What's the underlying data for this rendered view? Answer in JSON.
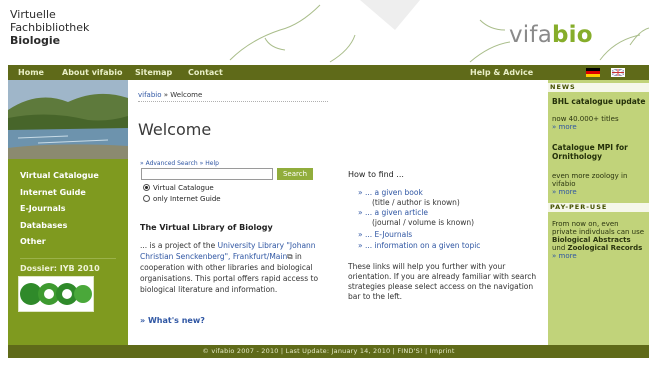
{
  "header": {
    "logo_line1": "Virtuelle",
    "logo_line2": "Fachbibliothek",
    "logo_line3": "Biologie",
    "brand_part1": "vifa",
    "brand_part2": "bio"
  },
  "nav": {
    "home": "Home",
    "about": "About vifabio",
    "sitemap": "Sitemap",
    "contact": "Contact",
    "help": "Help & Advice"
  },
  "leftnav": {
    "items": [
      "Virtual Catalogue",
      "Internet Guide",
      "E-Journals",
      "Databases",
      "Other"
    ],
    "dossier": "Dossier: IYB 2010",
    "logo_text": "2010"
  },
  "main": {
    "breadcrumb_link": "vifabio",
    "breadcrumb_sep": " » ",
    "breadcrumb_current": "Welcome",
    "title": "Welcome",
    "advanced_search": "» Advanced Search",
    "help": "» Help",
    "search_value": "",
    "search_button": "Search",
    "radio1": "Virtual Catalogue",
    "radio2": "only Internet Guide",
    "vlb_title": "The Virtual Library of Biology",
    "vlb_text1": "... is a project of the ",
    "vlb_link": "University Library \"Johann Christian Senckenberg\", Frankfurt/Main",
    "vlb_text2": " in cooperation with other libraries and biological organisations. This portal offers rapid access to biological literature and information.",
    "whats_new": "» What's new?",
    "howto_title": "How to find ...",
    "howto_items": [
      {
        "link": "» ... a given book",
        "sub": "(title / author is known)"
      },
      {
        "link": "» ... a given article",
        "sub": "(journal / volume is known)"
      },
      {
        "link": "» ... E-Journals",
        "sub": ""
      },
      {
        "link": "» ... information on a given topic",
        "sub": ""
      }
    ],
    "howto_text": "These links will help you further with your orientation. If you are already familiar with search strategies please select access on the navigation bar to the left."
  },
  "right": {
    "news_head": "NEWS",
    "news1_title": "BHL catalogue update",
    "news1_text": "now 40.000+ titles",
    "news1_more": "» more",
    "news2_title_l1": "Catalogue MPI for",
    "news2_title_l2": "Ornithology",
    "news2_text_l1": "even more zoology in",
    "news2_text_l2": "vifabio",
    "news2_more": "» more",
    "ppu_head": "PAY-PER-USE",
    "ppu_l1": "From now on, even",
    "ppu_l2": "private indivduals can use",
    "ppu_l3": "Biological Abstracts",
    "ppu_l4a": "und ",
    "ppu_l4b": "Zoological Records",
    "ppu_more": "» more"
  },
  "footer": {
    "text": "© vifabio 2007 - 2010 | Last Update: January 14, 2010 | FIND'S! | Imprint"
  }
}
